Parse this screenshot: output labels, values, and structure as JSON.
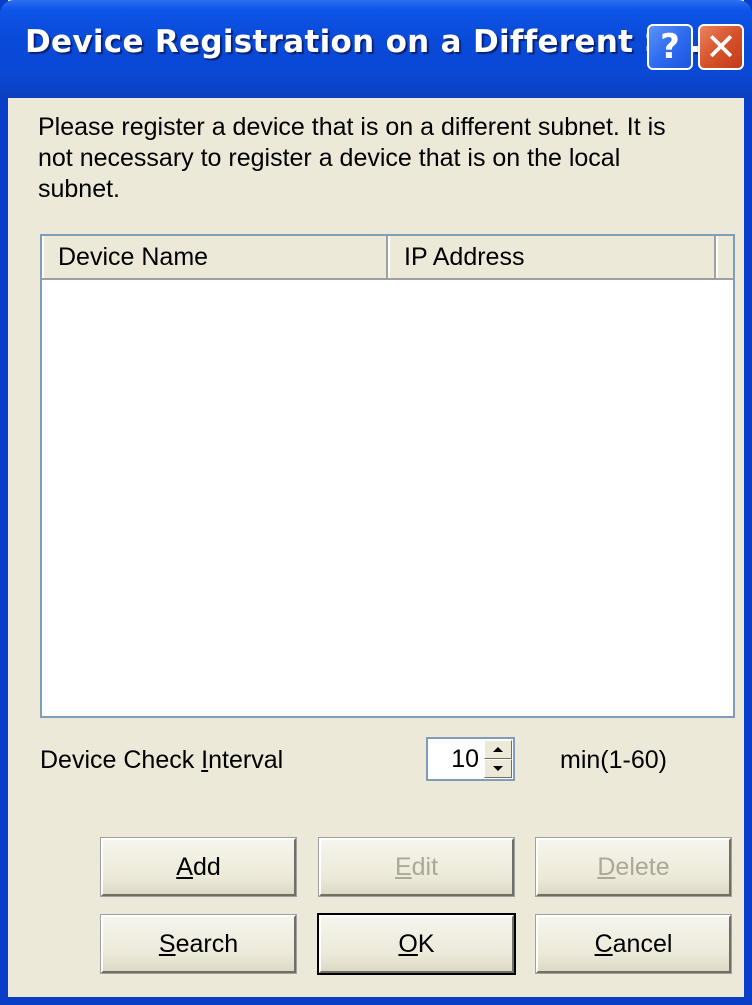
{
  "window": {
    "title": "Device Registration on a Different Su...",
    "help_glyph": "?",
    "close_glyph": "✕"
  },
  "description": "Please register a device that is on a different subnet. It is not necessary to register a device that is on the local subnet.",
  "device_list": {
    "columns": [
      "Device Name",
      "IP Address"
    ],
    "rows": []
  },
  "interval": {
    "label_pre": "Device Check ",
    "label_mnemonic": "I",
    "label_post": "nterval",
    "value": "10",
    "range_label": "min(1-60)"
  },
  "buttons": {
    "add": {
      "mnemonic": "A",
      "rest": "dd",
      "enabled": true
    },
    "edit": {
      "mnemonic": "E",
      "rest": "dit",
      "enabled": false
    },
    "delete": {
      "mnemonic": "D",
      "rest": "elete",
      "enabled": false
    },
    "search": {
      "mnemonic": "S",
      "rest": "earch",
      "enabled": true
    },
    "ok": {
      "mnemonic": "O",
      "rest": "K",
      "enabled": true
    },
    "cancel": {
      "mnemonic": "C",
      "rest": "ancel",
      "enabled": true
    }
  },
  "colors": {
    "title_bar": "#0a4ad8",
    "dialog_bg": "#ece9d8",
    "close_button": "#d7532b",
    "disabled_text": "#aca899"
  }
}
